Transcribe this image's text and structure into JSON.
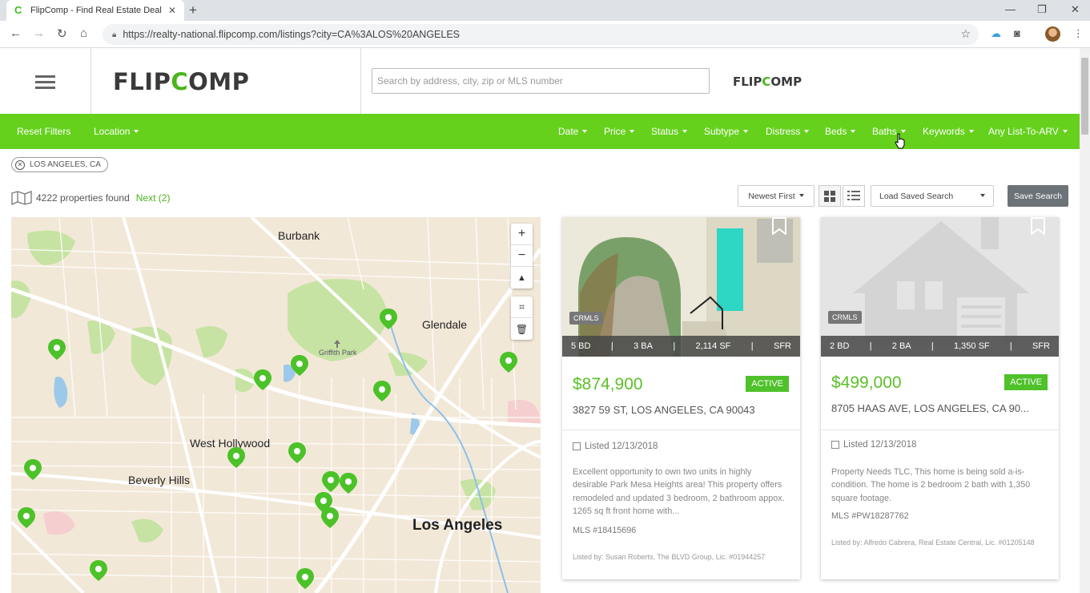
{
  "browser": {
    "tab_title": "FlipComp - Find Real Estate Deal",
    "new_tab": "+",
    "url": "https://realty-national.flipcomp.com/listings?city=CA%3ALOS%20ANGELES"
  },
  "header": {
    "logo_left": "FLIP",
    "logo_mid": "C",
    "logo_right": "OMP",
    "search_placeholder": "Search by address, city, zip or MLS number"
  },
  "filters": {
    "reset": "Reset Filters",
    "location": "Location",
    "items": [
      "Date",
      "Price",
      "Status",
      "Subtype",
      "Distress",
      "Beds",
      "Baths",
      "Keywords",
      "Any List-To-ARV"
    ]
  },
  "chip": "LOS ANGELES, CA",
  "results": {
    "count_text": "4222 properties found",
    "next": "Next (2)"
  },
  "toolbar": {
    "sort": "Newest First",
    "load_saved": "Load Saved Search",
    "save": "Save Search"
  },
  "map": {
    "labels": [
      "Burbank",
      "Glendale",
      "Griffith Park",
      "West Hollywood",
      "Beverly Hills",
      "Los Angeles"
    ],
    "zoom_in": "+",
    "zoom_out": "−"
  },
  "listings": [
    {
      "source": "CRMLS",
      "beds": "5 BD",
      "baths": "3 BA",
      "sqft": "2,114 SF",
      "type": "SFR",
      "price": "$874,900",
      "status": "ACTIVE",
      "address": "3827 59 ST, LOS ANGELES, CA 90043",
      "listed": "Listed 12/13/2018",
      "description": "Excellent opportunity to own two units in highly desirable Park Mesa Heights area! This property offers remodeled and updated 3 bedroom, 2 bathroom appox. 1265 sq ft front home with...",
      "mls": "MLS #18415696",
      "agent": "Listed by: Susan Roberts, The BLVD Group, Lic. #01944257"
    },
    {
      "source": "CRMLS",
      "beds": "2 BD",
      "baths": "2 BA",
      "sqft": "1,350 SF",
      "type": "SFR",
      "price": "$499,000",
      "status": "ACTIVE",
      "address": "8705 HAAS AVE, LOS ANGELES, CA 90...",
      "listed": "Listed 12/13/2018",
      "description": "Property Needs TLC, This home is being sold a-is-condition. The home is 2 bedroom 2 bath with 1,350 square footage.",
      "mls": "MLS #PW18287762",
      "agent": "Listed by: Alfredo Cabrera, Real Estate Central, Lic. #01205148"
    }
  ],
  "colors": {
    "brand_green": "#65d11d",
    "price_green": "#5cbf2a",
    "pin_green": "#4cc229"
  }
}
